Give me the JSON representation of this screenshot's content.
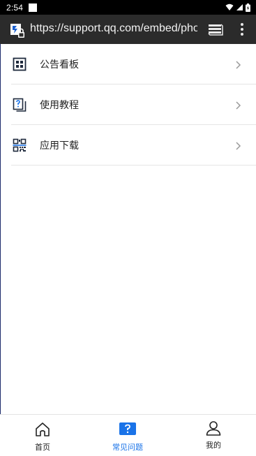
{
  "status_bar": {
    "time": "2:54"
  },
  "browser": {
    "url": "https://support.qq.com/embed/phor"
  },
  "menu_items": [
    {
      "label": "公告看板",
      "icon": "dashboard-icon"
    },
    {
      "label": "使用教程",
      "icon": "help-document-icon"
    },
    {
      "label": "应用下载",
      "icon": "qr-code-icon"
    }
  ],
  "bottom_nav": {
    "tabs": [
      {
        "label": "首页",
        "icon": "home-icon",
        "active": false
      },
      {
        "label": "常见问题",
        "icon": "question-icon",
        "active": true
      },
      {
        "label": "我的",
        "icon": "user-icon",
        "active": false
      }
    ],
    "active_color": "#1a73e8"
  }
}
